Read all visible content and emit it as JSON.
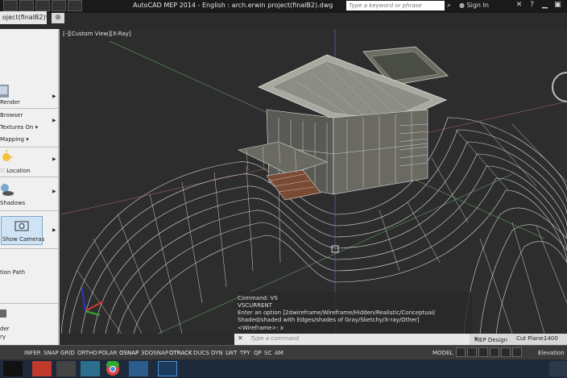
{
  "window": {
    "title": "AutoCAD MEP 2014 - English : arch.erwin project(finalB2).dwg",
    "file_tab": "oject(finalB2)*",
    "search_placeholder": "Type a keyword or phrase",
    "signin": "Sign In"
  },
  "palette": {
    "items": [
      "Render",
      "Browser",
      "Textures On",
      "Mapping",
      "Location",
      "Shadows",
      "Show Cameras",
      "tion Path",
      "der",
      "ry"
    ],
    "selected": "Show Cameras"
  },
  "viewport": {
    "label": "[-][Custom View][X-Ray]"
  },
  "command": {
    "history": [
      "Command: VS",
      "VSCURRENT",
      "Enter an option [2dwireframe/Wireframe/Hidden/Realistic/Conceptual/",
      "Shaded/shaded with Edges/shades of Gray/Sketchy/X-ray/Other]",
      "<Wireframe>: x"
    ],
    "input_placeholder": "Type a command"
  },
  "statusbar": {
    "toggles": [
      "INFER",
      "SNAP",
      "GRID",
      "ORTHO",
      "POLAR",
      "OSNAP",
      "3DOSNAP",
      "OTRACK",
      "DUCS",
      "DYN",
      "LWT",
      "TPY",
      "QP",
      "SC",
      "AM"
    ],
    "active": [
      "OSNAP",
      "OTRACK"
    ],
    "model": "MODEL",
    "workspace": "MEP Design",
    "cut_plane_label": "Cut Plane:",
    "cut_plane_value": "1400",
    "elevation_label": "Elevation"
  },
  "colors": {
    "accent_blue": "#4a8fd6",
    "viewport_bg": "#2d2d2d",
    "wireframe": "#d8d8d8"
  }
}
